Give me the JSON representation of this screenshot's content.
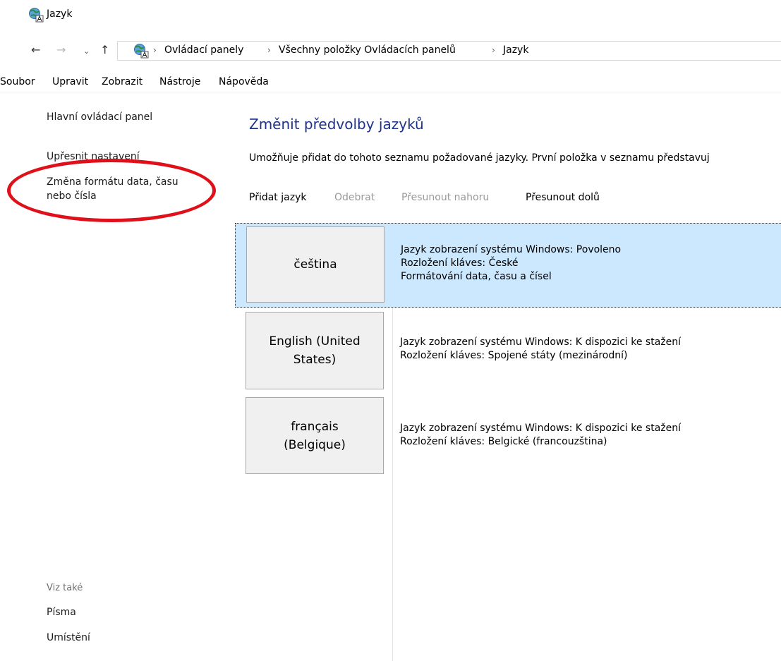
{
  "window": {
    "title": "Jazyk"
  },
  "navigation": {
    "back_glyph": "←",
    "forward_glyph": "→",
    "recent_glyph": "⌄",
    "up_glyph": "↑",
    "breadcrumbs": [
      "Ovládací panely",
      "Všechny položky Ovládacích panelů",
      "Jazyk"
    ],
    "separator": "›"
  },
  "menu": {
    "items": [
      "Soubor",
      "Upravit",
      "Zobrazit",
      "Nástroje",
      "Nápověda"
    ]
  },
  "sidebar": {
    "home_link": "Hlavní ovládací panel",
    "advanced_link": "Upřesnit nastavení",
    "format_link_line1": "Změna formátu data, času",
    "format_link_line2": "nebo čísla",
    "see_also": "Viz také",
    "fonts_link": "Písma",
    "location_link": "Umístění"
  },
  "main": {
    "heading": "Změnit předvolby jazyků",
    "description": "Umožňuje přidat do tohoto seznamu požadované jazyky. První položka v seznamu představuj",
    "toolbar": {
      "add": "Přidat jazyk",
      "remove": "Odebrat",
      "move_up": "Přesunout nahoru",
      "move_down": "Přesunout dolů"
    },
    "languages": [
      {
        "name_line1": "čeština",
        "name_line2": "",
        "details": [
          "Jazyk zobrazení systému Windows: Povoleno",
          "Rozložení kláves: České",
          "Formátování data, času a čísel"
        ],
        "selected": true
      },
      {
        "name_line1": "English (United",
        "name_line2": "States)",
        "details": [
          "Jazyk zobrazení systému Windows: K dispozici ke stažení",
          "Rozložení kláves: Spojené státy (mezinárodní)"
        ],
        "selected": false
      },
      {
        "name_line1": "français",
        "name_line2": "(Belgique)",
        "details": [
          "Jazyk zobrazení systému Windows: K dispozici ke stažení",
          "Rozložení kláves: Belgické (francouzština)"
        ],
        "selected": false
      }
    ]
  },
  "colors": {
    "heading": "#1e3287",
    "selection": "#cce8ff",
    "annotation": "#e0101a",
    "disabled_text": "#9a9a9a"
  },
  "icons": {
    "app": "language-globe-icon"
  }
}
